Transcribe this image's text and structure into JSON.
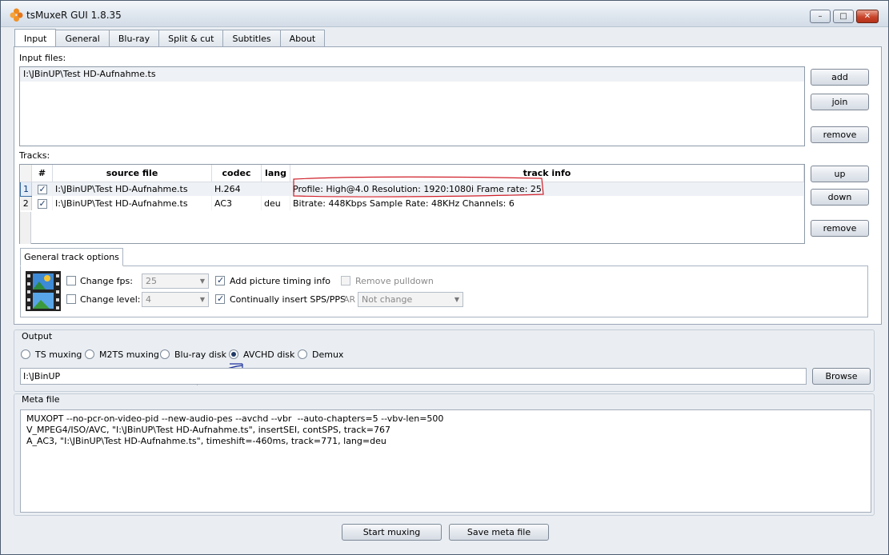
{
  "window": {
    "title": "tsMuxeR GUI 1.8.35",
    "min_label": "–",
    "max_label": "□",
    "close_label": "✕"
  },
  "tabs": [
    "Input",
    "General",
    "Blu-ray",
    "Split & cut",
    "Subtitles",
    "About"
  ],
  "input": {
    "label": "Input files:",
    "files": [
      "I:\\JBinUP\\Test HD-Aufnahme.ts"
    ],
    "add": "add",
    "join": "join",
    "remove": "remove"
  },
  "tracks": {
    "label": "Tracks:",
    "headers": [
      "#",
      "source file",
      "codec",
      "lang",
      "track info"
    ],
    "rows": [
      {
        "num": "1",
        "checked": true,
        "file": "I:\\JBinUP\\Test HD-Aufnahme.ts",
        "codec": "H.264",
        "lang": "",
        "info": "Profile: High@4.0  Resolution: 1920:1080i  Frame rate: 25"
      },
      {
        "num": "2",
        "checked": true,
        "file": "I:\\JBinUP\\Test HD-Aufnahme.ts",
        "codec": "AC3",
        "lang": "deu",
        "info": "Bitrate: 448Kbps Sample Rate: 48KHz Channels: 6"
      }
    ],
    "up": "up",
    "down": "down",
    "remove": "remove"
  },
  "track_options": {
    "tab_label": "General track options",
    "change_fps": "Change fps:",
    "fps_value": "25",
    "change_level": "Change level:",
    "level_value": "4",
    "picture_timing": "Add picture timing info",
    "sps_pps": "Continually insert SPS/PPS",
    "remove_pulldown": "Remove pulldown",
    "ar_label": "AR",
    "ar_value": "Not change"
  },
  "output": {
    "label": "Output",
    "modes": [
      "TS muxing",
      "M2TS muxing",
      "Blu-ray disk",
      "AVCHD disk",
      "Demux"
    ],
    "selected": "AVCHD disk",
    "path": "I:\\JBinUP",
    "browse": "Browse"
  },
  "meta": {
    "label": "Meta file",
    "lines": [
      "MUXOPT --no-pcr-on-video-pid --new-audio-pes --avchd --vbr  --auto-chapters=5 --vbv-len=500",
      "V_MPEG4/ISO/AVC, \"I:\\JBinUP\\Test HD-Aufnahme.ts\", insertSEI, contSPS, track=767",
      "A_AC3, \"I:\\JBinUP\\Test HD-Aufnahme.ts\", timeshift=-460ms, track=771, lang=deu"
    ]
  },
  "footer": {
    "start": "Start muxing",
    "save": "Save meta file"
  }
}
